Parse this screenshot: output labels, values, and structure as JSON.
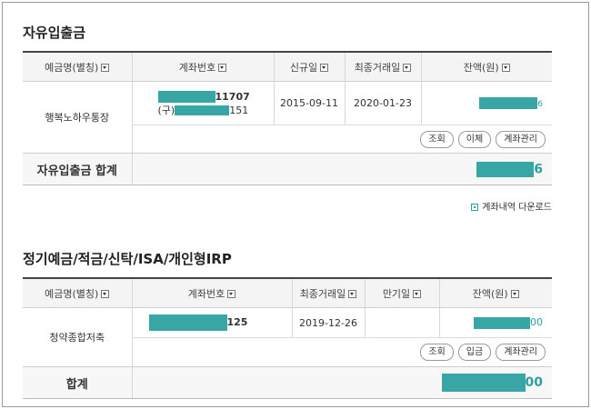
{
  "sections": [
    {
      "title": "자유입출금",
      "headers": [
        "예금명(별칭)",
        "계좌번호",
        "신규일",
        "최종거래일",
        "잔액(원)"
      ],
      "account": {
        "name": "행복노하우통장",
        "number_suffix": "11707",
        "old_prefix": "(구)",
        "old_suffix": "151",
        "open_date": "2015-09-11",
        "last_tx_date": "2020-01-23",
        "balance_suffix": "6"
      },
      "buttons": [
        "조회",
        "이체",
        "계좌관리"
      ],
      "total_label": "자유입출금 합계",
      "total_suffix": "6"
    },
    {
      "title": "정기예금/적금/신탁/ISA/개인형IRP",
      "headers": [
        "예금명(별칭)",
        "계좌번호",
        "최종거래일",
        "만기일",
        "잔액(원)"
      ],
      "account": {
        "name": "청약종합저축",
        "number_suffix": "125",
        "last_tx_date": "2019-12-26",
        "maturity_date": "",
        "balance_suffix": "00"
      },
      "buttons": [
        "조회",
        "입금",
        "계좌관리"
      ],
      "total_label": "합계",
      "total_suffix": "00"
    }
  ],
  "download_link": "계좌내역 다운로드",
  "colors": {
    "accent": "#2f9e9e",
    "redaction": "#39a6a6",
    "header_bg": "#f4f4f4"
  }
}
